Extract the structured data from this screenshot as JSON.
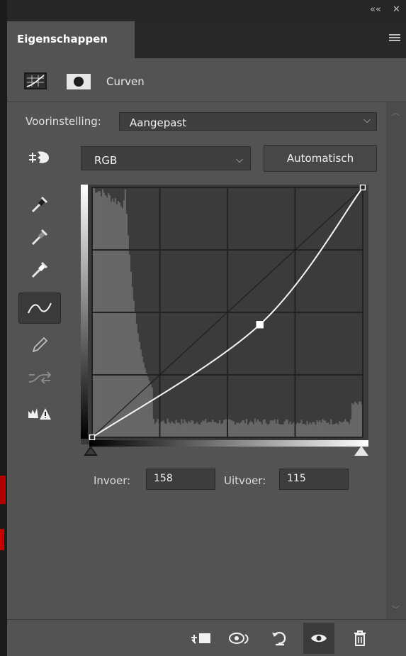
{
  "window": {
    "collapse_glyph": "««",
    "close_glyph": "✕"
  },
  "tab": {
    "title": "Eigenschappen",
    "menu_icon": "hamburger-menu-icon"
  },
  "header": {
    "adjustment_icon": "curves-adjustment-icon",
    "mask_icon": "layer-mask-icon",
    "title": "Curven"
  },
  "preset": {
    "label": "Voorinstelling:",
    "value": "Aangepast"
  },
  "channel": {
    "value": "RGB"
  },
  "auto_button": {
    "label": "Automatisch"
  },
  "tools": [
    "on-image-adjust-icon",
    "black-point-eyedropper-icon",
    "gray-point-eyedropper-icon",
    "white-point-eyedropper-icon",
    "edit-points-curve-icon",
    "pencil-draw-icon",
    "smooth-curve-icon",
    "clipping-warning-icon"
  ],
  "curve": {
    "points": [
      [
        0,
        0
      ],
      [
        158,
        115
      ],
      [
        255,
        255
      ]
    ],
    "selected_point": [
      158,
      115
    ],
    "input_range": [
      0,
      255
    ],
    "output_range": [
      0,
      255
    ],
    "grid_divisions": 4
  },
  "io": {
    "input_label": "Invoer:",
    "input_value": "158",
    "output_label": "Uitvoer:",
    "output_value": "115"
  },
  "bottom_icons": [
    "clip-to-layer-icon",
    "view-previous-state-icon",
    "reset-icon",
    "visibility-eye-icon",
    "delete-trash-icon"
  ],
  "colors": {
    "panel_bg": "#535353",
    "graph_bg": "#3b3b3b",
    "histogram": "#6e6e6e",
    "curve": "#f5f5f5"
  }
}
